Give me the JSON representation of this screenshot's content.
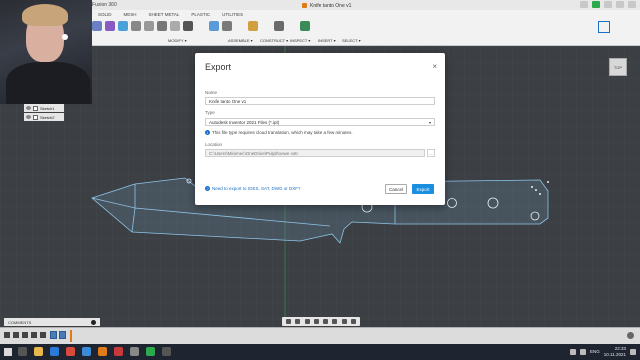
{
  "window": {
    "app_title": "Fusion 360",
    "doc_tab": "Knife tanto One v1"
  },
  "toolbar": {
    "tabs": [
      "SOLID",
      "MESH",
      "SHEET METAL",
      "PLASTIC",
      "UTILITIES"
    ],
    "active_tab": "SOLID",
    "groups": [
      "MODIFY ▾",
      "ASSEMBLE ▾",
      "CONSTRUCT ▾",
      "INSPECT ▾",
      "INSERT ▾",
      "SELECT ▾"
    ]
  },
  "browser": {
    "items": [
      {
        "label": "Sketch1"
      },
      {
        "label": "Sketch2"
      }
    ]
  },
  "viewcube": {
    "label": "TOP"
  },
  "dialog": {
    "title": "Export",
    "close_label": "×",
    "name_label": "Name",
    "name_value": "Knife tanto One v1",
    "type_label": "Type",
    "type_value": "Autodesk Inventor 2021 Files (*.ipt)",
    "info_text": "This file type requires cloud translation, which may take a few minutes.",
    "location_label": "Location",
    "location_value": "C:\\Users\\Minimec\\OneDrive\\Pulpit\\nowe ostr",
    "browse_label": "...",
    "help_link": "Need to export to IGES, SAT, DWG or DXF?",
    "cancel_label": "Cancel",
    "export_label": "Export"
  },
  "comments": {
    "label": "COMMENTS"
  },
  "taskbar": {
    "lang": "ENG",
    "time": "22:33",
    "date": "10.11.2021"
  },
  "colors": {
    "accent": "#1a8fe0",
    "sketch_line": "#8ec5ea",
    "background": "#3c4044"
  }
}
